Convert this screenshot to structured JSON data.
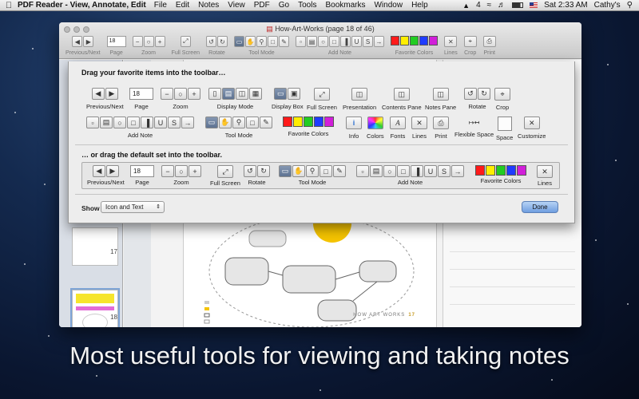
{
  "menubar": {
    "app_name": "PDF Reader - View, Annotate, Edit",
    "items": [
      "File",
      "Edit",
      "Notes",
      "View",
      "PDF",
      "Go",
      "Tools",
      "Bookmarks",
      "Window",
      "Help"
    ],
    "status_number": "4",
    "clock": "Sat 2:33 AM",
    "user": "Cathy's"
  },
  "window": {
    "title": "How-Art-Works (page 18 of 46)",
    "toolbar": {
      "page_value": "18",
      "labels": {
        "prev_next": "Previous/Next",
        "page": "Page",
        "zoom": "Zoom",
        "full_screen": "Full Screen",
        "rotate": "Rotate",
        "tool_mode": "Tool Mode",
        "add_note": "Add Note",
        "favorite_colors": "Favorite Colors",
        "lines": "Lines",
        "crop": "Crop",
        "print": "Print"
      }
    },
    "sidebar": {
      "page_numbers": [
        "17",
        "18"
      ]
    },
    "page_footer": {
      "text": "HOW ART WORKS",
      "number": "17"
    }
  },
  "favorite_colors": [
    "#ff1a1a",
    "#ffee00",
    "#22cc22",
    "#1f3cff",
    "#d11fd9"
  ],
  "sheet": {
    "heading_favorites": "Drag your favorite items into the toolbar…",
    "heading_default": "… or drag the default set into the toolbar.",
    "row1": {
      "prev_next": "Previous/Next",
      "page": "Page",
      "page_value": "18",
      "zoom": "Zoom",
      "display_mode": "Display Mode",
      "display_box": "Display Box",
      "full_screen": "Full Screen",
      "presentation": "Presentation",
      "contents_pane": "Contents Pane",
      "notes_pane": "Notes Pane",
      "rotate": "Rotate",
      "crop": "Crop"
    },
    "row2": {
      "add_note": "Add Note",
      "tool_mode": "Tool Mode",
      "favorite_colors": "Favorite Colors",
      "info": "Info",
      "colors": "Colors",
      "fonts": "Fonts",
      "lines": "Lines",
      "print": "Print",
      "flexible_space": "Flexible Space",
      "space": "Space",
      "customize": "Customize"
    },
    "default_set": {
      "prev_next": "Previous/Next",
      "page": "Page",
      "page_value": "18",
      "zoom": "Zoom",
      "full_screen": "Full Screen",
      "rotate": "Rotate",
      "tool_mode": "Tool Mode",
      "add_note": "Add Note",
      "favorite_colors": "Favorite Colors",
      "lines": "Lines"
    },
    "show_label": "Show",
    "show_value": "Icon and Text",
    "done_label": "Done"
  },
  "caption": "Most useful tools for viewing and taking notes"
}
